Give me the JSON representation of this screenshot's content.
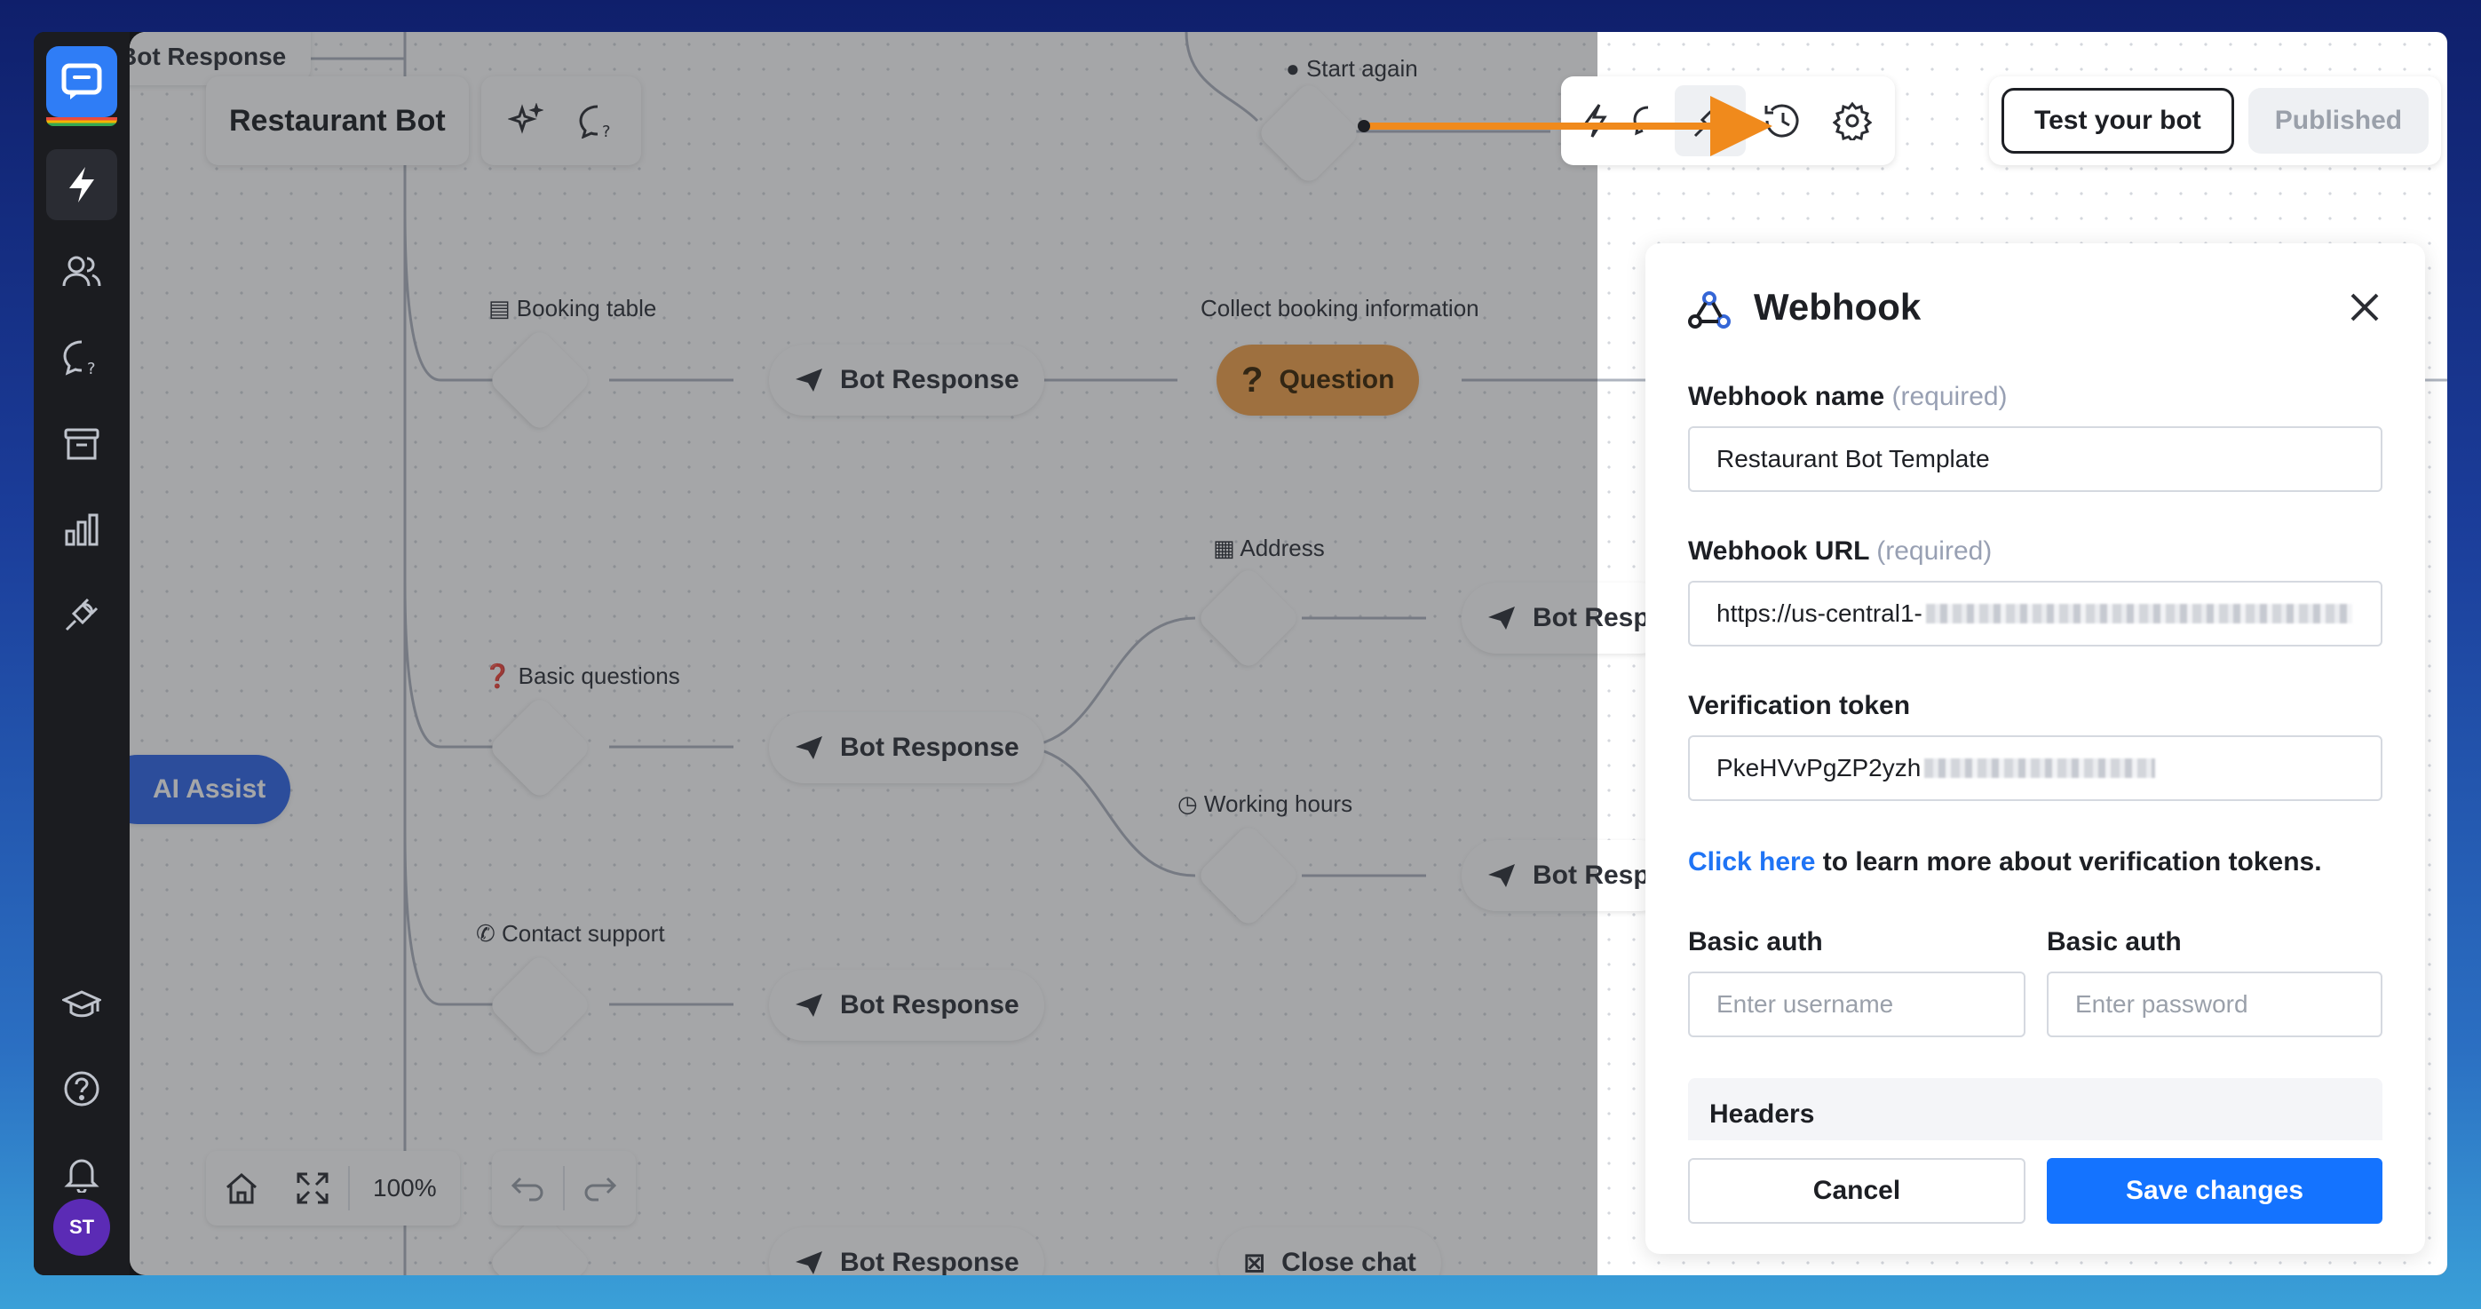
{
  "app": {
    "bot_name": "Restaurant Bot",
    "avatar_initials": "ST"
  },
  "toolbar": {
    "test_label": "Test your bot",
    "published_label": "Published"
  },
  "canvas": {
    "zoom": "100%",
    "nodes": {
      "start_again": "Start again",
      "booking_table": "Booking table",
      "collect_booking": "Collect booking information",
      "basic_questions": "Basic questions",
      "address": "Address",
      "working_hours": "Working hours",
      "contact_support": "Contact support",
      "bot_response": "Bot Response",
      "bot_resp_cut": "Bot Resp",
      "question": "Question",
      "ai_assist": "AI Assist",
      "close_chat": "Close chat",
      "top_bot_response": "Bot Response"
    }
  },
  "webhook": {
    "title": "Webhook",
    "name_label": "Webhook name",
    "required": "(required)",
    "name_value": "Restaurant Bot Template",
    "url_label": "Webhook URL",
    "url_value": "https://us-central1-",
    "token_label": "Verification token",
    "token_value": "PkeHVvPgZP2yzh",
    "link_text": "Click here",
    "link_suffix": " to learn more about verification tokens.",
    "basic_auth_label_1": "Basic auth",
    "basic_auth_label_2": "Basic auth",
    "username_placeholder": "Enter username",
    "password_placeholder": "Enter password",
    "headers_label": "Headers",
    "cancel_label": "Cancel",
    "save_label": "Save changes"
  },
  "colors": {
    "primary": "#1473ff",
    "question_node": "#f3a34b",
    "ai_assist": "#2f66e8",
    "arrow": "#f08a1c"
  }
}
